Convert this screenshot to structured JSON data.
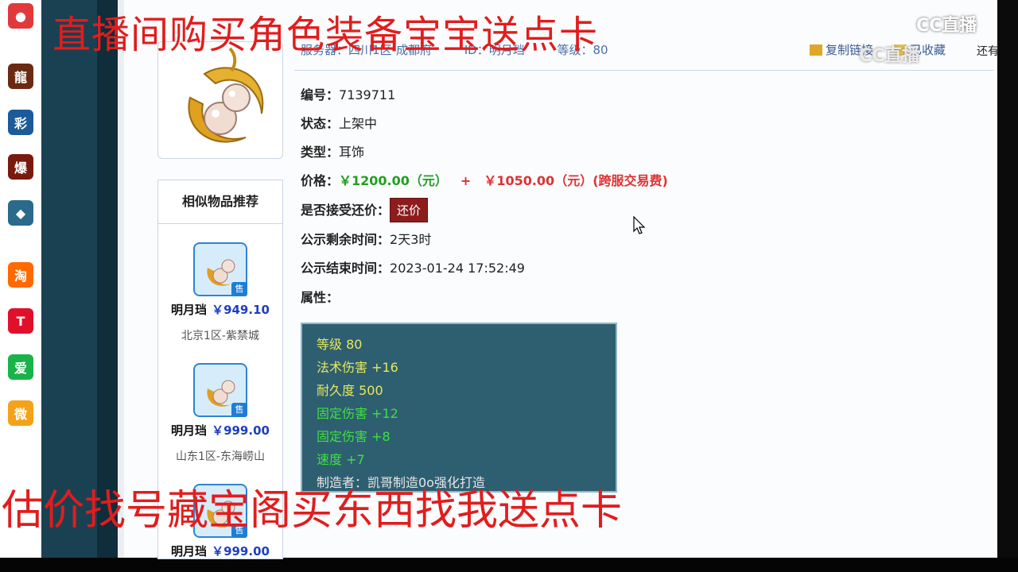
{
  "overlay": {
    "top": "直播间购买角色装备宝宝送点卡",
    "bottom": "估价找号藏宝阁买东西找我送点卡",
    "watermark": "CC直播"
  },
  "dock": {
    "icons": [
      {
        "name": "cc-app-icon",
        "color": "#e13a3a",
        "glyph": "●"
      },
      {
        "name": "game-icon-1",
        "color": "#6b2a12",
        "glyph": "龍"
      },
      {
        "name": "game-icon-2",
        "color": "#1c5a9a",
        "glyph": "彩"
      },
      {
        "name": "game-icon-3",
        "color": "#7a1a0e",
        "glyph": "爆"
      },
      {
        "name": "game-icon-4",
        "color": "#2a6a8a",
        "glyph": "◆"
      },
      {
        "name": "taobao-icon",
        "color": "#ff6a00",
        "glyph": "淘"
      },
      {
        "name": "tmall-icon",
        "color": "#e0102b",
        "glyph": "T"
      },
      {
        "name": "iqiyi-icon",
        "color": "#18b34a",
        "glyph": "爱"
      },
      {
        "name": "weibo-icon",
        "color": "#f4a21a",
        "glyph": "微"
      }
    ]
  },
  "header": {
    "meta": [
      "服务器：四川1区-成都府",
      "ID：明月珰",
      "等级：80"
    ],
    "copy_label": "复制链接",
    "fav_label": "已收藏",
    "more_label": "还有"
  },
  "similar": {
    "title": "相似物品推荐",
    "sale_badge": "售",
    "items": [
      {
        "name": "明月珰",
        "price": "￥949.10",
        "server": "北京1区-紫禁城"
      },
      {
        "name": "明月珰",
        "price": "￥999.00",
        "server": "山东1区-东海崂山"
      },
      {
        "name": "明月珰",
        "price": "￥999.00",
        "server": ""
      }
    ]
  },
  "detail": {
    "id_label": "编号：",
    "id_value": "7139711",
    "status_label": "状态：",
    "status_value": "上架中",
    "type_label": "类型：",
    "type_value": "耳饰",
    "price_label": "价格：",
    "price_main": "￥1200.00（元）",
    "price_plus": "+",
    "price_fee": "￥1050.00（元）(跨服交易费)",
    "counter_label": "是否接受还价：",
    "counter_button": "还价",
    "remain_label": "公示剩余时间：",
    "remain_value": "2天3时",
    "end_label": "公示结束时间：",
    "end_value": "2023-01-24 17:52:49",
    "attr_label": "属性："
  },
  "attributes": [
    {
      "text": "等级 80",
      "color": "#e8e85a"
    },
    {
      "text": "法术伤害 +16",
      "color": "#e8e85a"
    },
    {
      "text": "耐久度 500",
      "color": "#e8e85a"
    },
    {
      "text": "固定伤害 +12",
      "color": "#3ee03e"
    },
    {
      "text": "固定伤害 +8",
      "color": "#3ee03e"
    },
    {
      "text": "速度 +7",
      "color": "#3ee03e"
    },
    {
      "text": "制造者：凯哥制造0o强化打造",
      "color": "#e6e6e6"
    }
  ]
}
